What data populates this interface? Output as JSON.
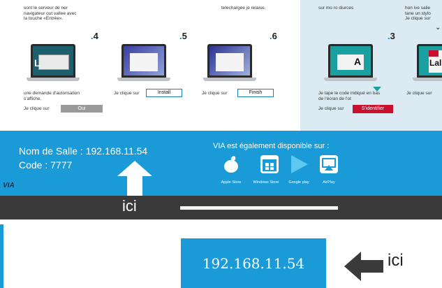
{
  "top_texts": {
    "col1_top": "sont le serveur de ner\nnavigateur out vallee avec\nla touche «Entrée».",
    "col2_top": "telechargee je relaise.",
    "col3_top": "sur mo ro diurces",
    "col4_top": "hon ive salie\ntane un stylo\nJe clique sur"
  },
  "steps": {
    "s4": {
      "num": "4",
      "desc": "une demande d'autorisation\ns'affiche.",
      "action": "Je clique sur",
      "button": "Oui"
    },
    "s5": {
      "num": "5",
      "action": "Je clique sur",
      "button": "Install"
    },
    "s6": {
      "num": "6",
      "action": "Je clique sur",
      "button": "Finish"
    },
    "s3": {
      "num": "3",
      "desc": "Je tape le code indiqué en bas\nde l'écran de l'ot",
      "action": "Je clique sur",
      "button": "S'identifier"
    },
    "s_next": {
      "action": "Je clique sur",
      "screen_text": "Lal"
    }
  },
  "screen_labels": {
    "s3": "A",
    "s4": "L"
  },
  "banner": {
    "room_label": "Nom de Salle : 192.168.11.54",
    "code_label": "Code : 7777",
    "available_title": "VIA est également disponible sur :",
    "stores": [
      "Apple Store",
      "Windows Store",
      "Google play",
      "AirPlay"
    ],
    "logo": "VIA",
    "ici_label": "ici"
  },
  "bottom": {
    "ip": "192.168.11.54",
    "ici_label": "ici"
  },
  "colors": {
    "accent": "#1a9ad6",
    "red": "#c8102e",
    "dark": "#3a3a3a"
  }
}
